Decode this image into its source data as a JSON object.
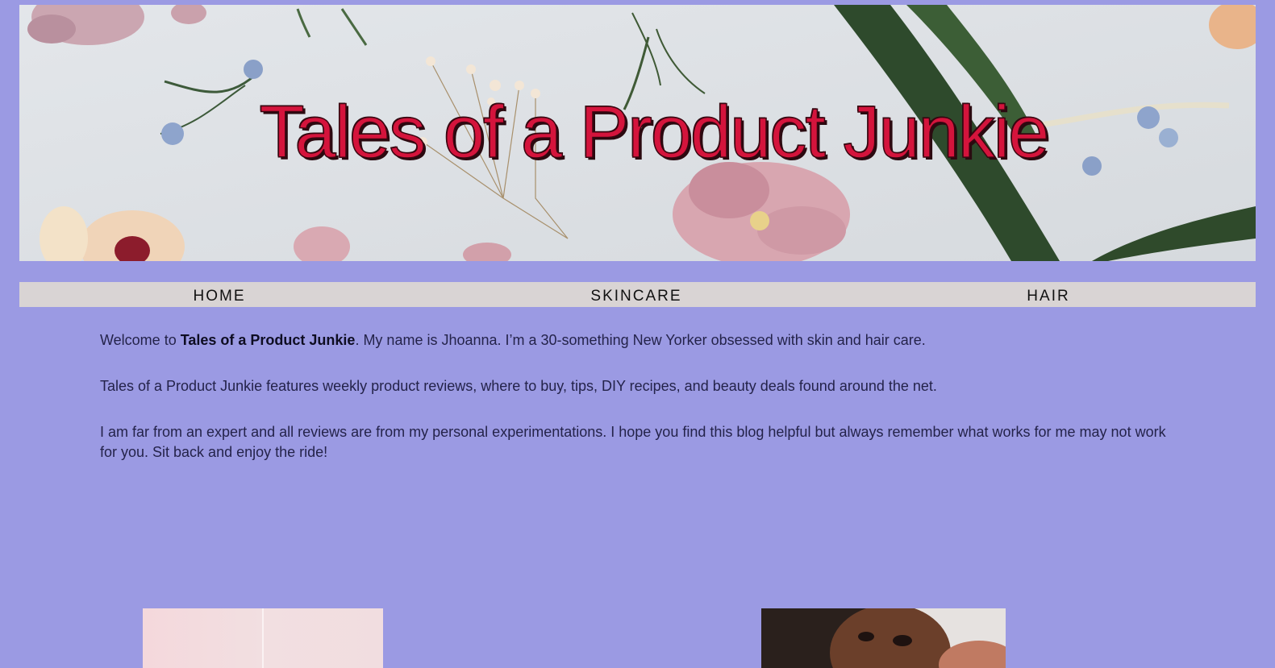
{
  "header": {
    "site_title": "Tales of a Product Junkie"
  },
  "nav": {
    "items": [
      {
        "label": "HOME"
      },
      {
        "label": "SKINCARE"
      },
      {
        "label": "HAIR"
      }
    ]
  },
  "intro": {
    "p1_prefix": "Welcome to ",
    "p1_bold": "Tales of a Product Junkie",
    "p1_suffix": ". My name is Jhoanna. I’m a 30-something New Yorker obsessed with skin and hair care.",
    "p2": "Tales of a Product Junkie features weekly product reviews, where to buy, tips, DIY recipes, and beauty deals found around the net.",
    "p3": "I am far from an expert and all reviews are from my personal experimentations. I hope you find this blog helpful but always remember what works for me may not work for you. Sit back and enjoy the ride!"
  },
  "colors": {
    "page_background": "#9b9ae3",
    "title_color": "#d4143c",
    "nav_background": "#d9d4d4"
  }
}
